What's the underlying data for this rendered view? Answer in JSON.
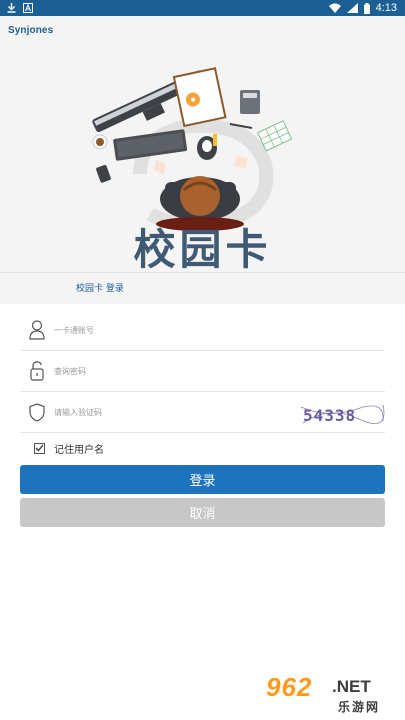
{
  "status_bar": {
    "time": "4:13"
  },
  "app": {
    "logo_text": "Synjones",
    "title": "校园卡",
    "breadcrumb": "校园卡 登录"
  },
  "form": {
    "account_placeholder": "一卡通账号",
    "password_placeholder": "查询密码",
    "captcha_placeholder": "请输入验证码",
    "captcha_text": "54338",
    "remember_label": "记住用户名",
    "remember_checked": true
  },
  "buttons": {
    "login": "登录",
    "cancel": "取消"
  },
  "watermark": {
    "number": "962",
    "suffix": ".NET",
    "site": "乐游网"
  },
  "colors": {
    "status_bar": "#1c5f93",
    "primary": "#1e73bd",
    "cancel": "#c7c7c7",
    "hero_bg": "#f4f4f4",
    "brand": "#3f5a72"
  }
}
